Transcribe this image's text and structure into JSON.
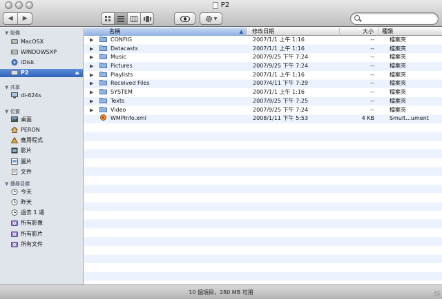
{
  "window": {
    "title": "P2"
  },
  "toolbar": {
    "nav_back": "◀",
    "nav_forward": "▶",
    "search_placeholder": ""
  },
  "sidebar": {
    "devices_header": "設備",
    "devices": [
      {
        "label": "MacOSX",
        "icon": "hard-drive-icon"
      },
      {
        "label": "WINDOWSXP",
        "icon": "hard-drive-icon"
      },
      {
        "label": "iDisk",
        "icon": "idisk-icon"
      },
      {
        "label": "P2",
        "icon": "external-drive-icon",
        "selected": true
      }
    ],
    "shared_header": "共享",
    "shared": [
      {
        "label": "di-624s",
        "icon": "network-computer-icon"
      }
    ],
    "places_header": "位置",
    "places": [
      {
        "label": "桌面",
        "icon": "desktop-icon"
      },
      {
        "label": "PERON",
        "icon": "home-icon"
      },
      {
        "label": "應用程式",
        "icon": "applications-icon"
      },
      {
        "label": "影片",
        "icon": "movies-icon"
      },
      {
        "label": "圖片",
        "icon": "pictures-icon"
      },
      {
        "label": "文件",
        "icon": "documents-icon"
      }
    ],
    "search_header": "搜尋目標",
    "searches": [
      {
        "label": "今天",
        "icon": "clock-icon"
      },
      {
        "label": "昨天",
        "icon": "clock-icon"
      },
      {
        "label": "過去 1 週",
        "icon": "clock-icon"
      },
      {
        "label": "所有影像",
        "icon": "smart-folder-icon"
      },
      {
        "label": "所有影片",
        "icon": "smart-folder-icon"
      },
      {
        "label": "所有文件",
        "icon": "smart-folder-icon"
      }
    ]
  },
  "columns": {
    "name": "名稱",
    "date": "修改日期",
    "size": "大小",
    "kind": "種類",
    "sort_indicator": "▲"
  },
  "files": [
    {
      "name": "CONFIG",
      "date": "2007/1/1 上午 1:16",
      "size": "--",
      "kind": "檔案夾",
      "type": "folder"
    },
    {
      "name": "Datacasts",
      "date": "2007/1/1 上午 1:16",
      "size": "--",
      "kind": "檔案夾",
      "type": "folder"
    },
    {
      "name": "Music",
      "date": "2007/9/25 下午 7:24",
      "size": "--",
      "kind": "檔案夾",
      "type": "folder"
    },
    {
      "name": "Pictures",
      "date": "2007/9/25 下午 7:24",
      "size": "--",
      "kind": "檔案夾",
      "type": "folder"
    },
    {
      "name": "Playlists",
      "date": "2007/1/1 上午 1:16",
      "size": "--",
      "kind": "檔案夾",
      "type": "folder"
    },
    {
      "name": "Received Files",
      "date": "2007/4/11 下午 7:29",
      "size": "--",
      "kind": "檔案夾",
      "type": "folder"
    },
    {
      "name": "SYSTEM",
      "date": "2007/1/1 上午 1:16",
      "size": "--",
      "kind": "檔案夾",
      "type": "folder"
    },
    {
      "name": "Texts",
      "date": "2007/9/25 下午 7:25",
      "size": "--",
      "kind": "檔案夾",
      "type": "folder"
    },
    {
      "name": "Video",
      "date": "2007/9/25 下午 7:24",
      "size": "--",
      "kind": "檔案夾",
      "type": "folder"
    },
    {
      "name": "WMPInfo.xml",
      "date": "2008/1/11 下午 5:53",
      "size": "4 KB",
      "kind": "Smult...ument",
      "type": "file"
    }
  ],
  "status": {
    "text": "10 個項目，280 MB 可用"
  },
  "colors": {
    "selection": "#3a6fc4",
    "folder": "#8fb4e3",
    "stripe": "#edf3fe"
  }
}
